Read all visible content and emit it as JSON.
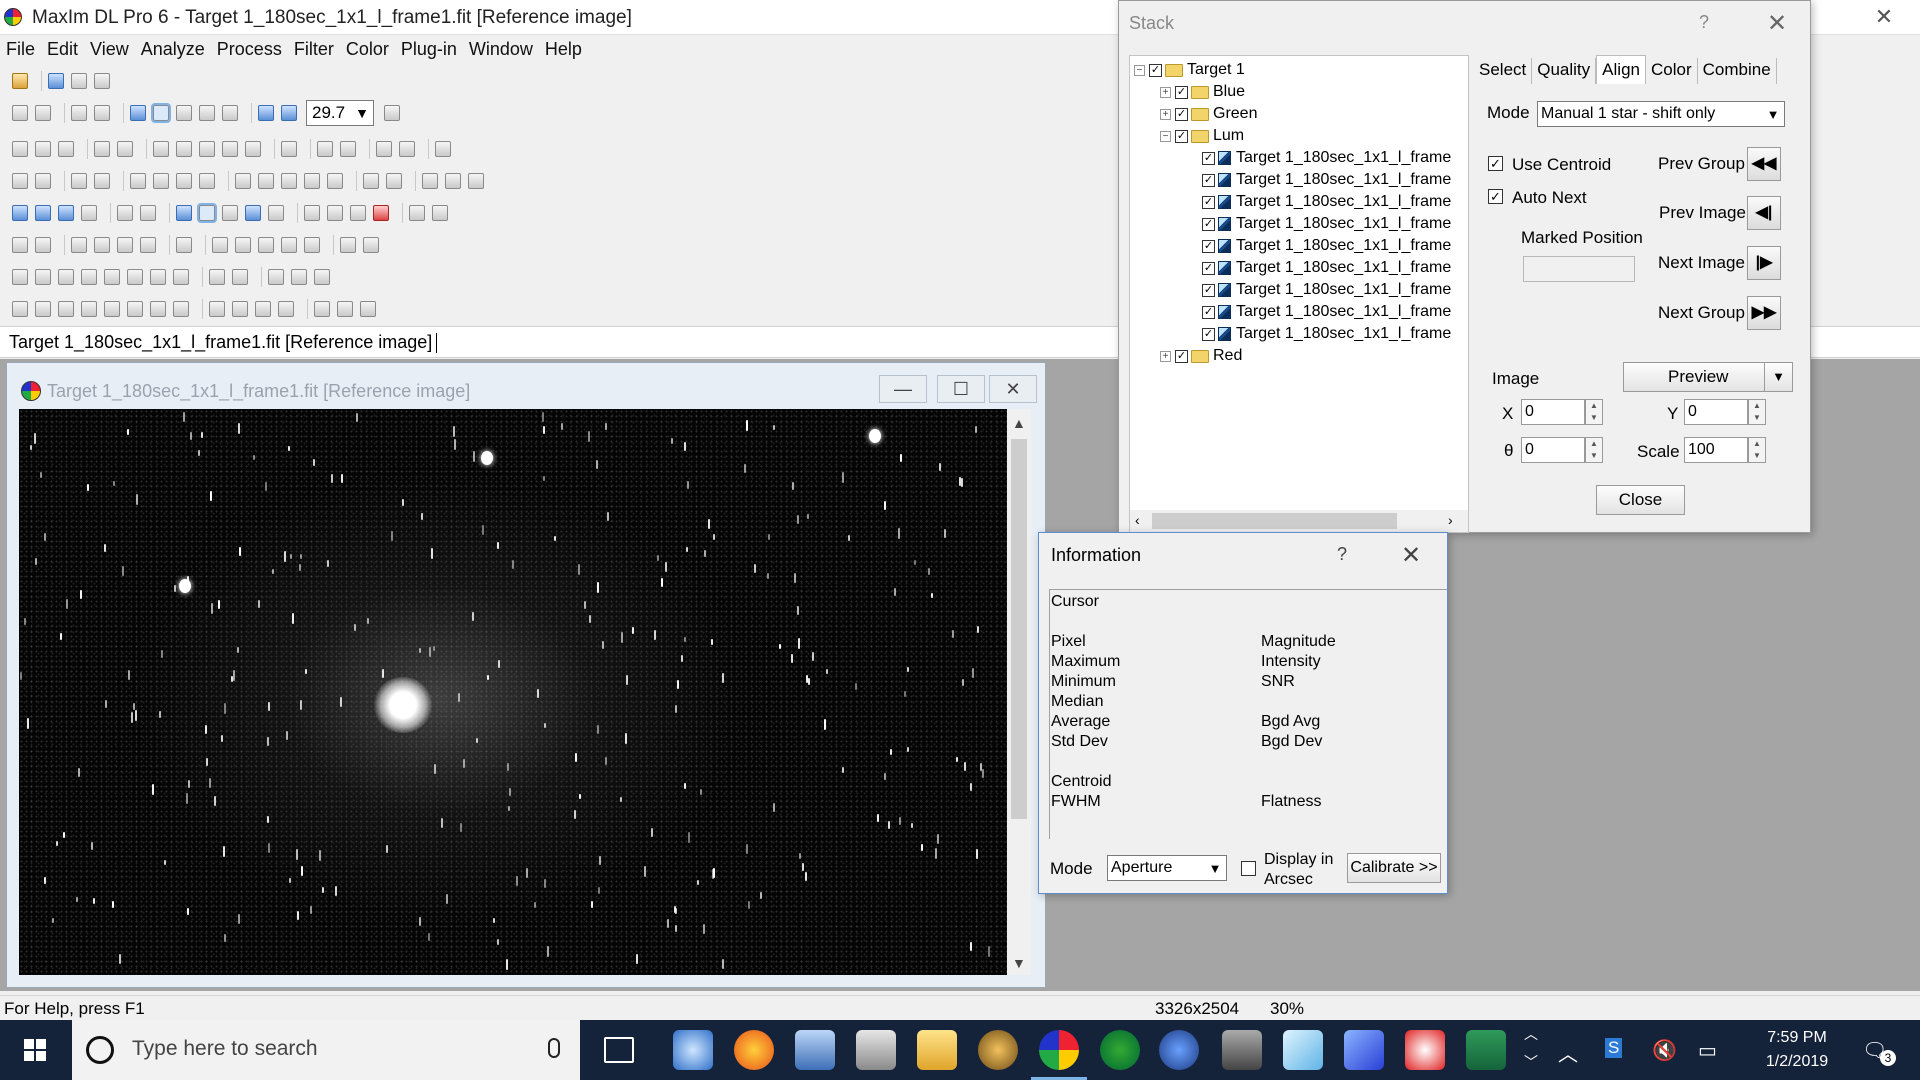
{
  "app": {
    "title": "MaxIm DL Pro 6 - Target 1_180sec_1x1_l_frame1.fit [Reference image]",
    "menu": [
      "File",
      "Edit",
      "View",
      "Analyze",
      "Process",
      "Filter",
      "Color",
      "Plug-in",
      "Window",
      "Help"
    ],
    "zoom": "29.7",
    "doc_tab": "Target 1_180sec_1x1_l_frame1.fit [Reference image]"
  },
  "image_window": {
    "title": "Target 1_180sec_1x1_l_frame1.fit [Reference image]",
    "minimize": "—",
    "maximize": "☐",
    "close": "✕"
  },
  "status": {
    "help": "For Help, press F1",
    "dims": "3326x2504",
    "zoom": "30%"
  },
  "stack": {
    "title": "Stack",
    "help": "?",
    "close_x": "✕",
    "tree": {
      "root": "Target 1",
      "groups": [
        "Blue",
        "Green",
        "Lum",
        "Red"
      ],
      "frames": [
        "Target 1_180sec_1x1_l_frame",
        "Target 1_180sec_1x1_l_frame",
        "Target 1_180sec_1x1_l_frame",
        "Target 1_180sec_1x1_l_frame",
        "Target 1_180sec_1x1_l_frame",
        "Target 1_180sec_1x1_l_frame",
        "Target 1_180sec_1x1_l_frame",
        "Target 1_180sec_1x1_l_frame",
        "Target 1_180sec_1x1_l_frame"
      ]
    },
    "tabs": [
      "Select",
      "Quality",
      "Align",
      "Color",
      "Combine"
    ],
    "active_tab": "Align",
    "mode_label": "Mode",
    "mode_value": "Manual 1 star - shift only",
    "use_centroid": "Use Centroid",
    "auto_next": "Auto Next",
    "marked_position": "Marked Position",
    "prev_group": "Prev Group",
    "prev_image": "Prev Image",
    "next_image": "Next Image",
    "next_group": "Next Group",
    "image_label": "Image",
    "preview": "Preview",
    "x_label": "X",
    "x_value": "0",
    "y_label": "Y",
    "y_value": "0",
    "theta_label": "θ",
    "theta_value": "0",
    "scale_label": "Scale",
    "scale_value": "100",
    "close_button": "Close"
  },
  "info": {
    "title": "Information",
    "help": "?",
    "close_x": "✕",
    "cursor": "Cursor",
    "left_labels": [
      "Pixel",
      "Maximum",
      "Minimum",
      "Median",
      "Average",
      "Std Dev",
      "",
      "Centroid",
      "FWHM"
    ],
    "right_labels": [
      "Magnitude",
      "Intensity",
      "SNR",
      "",
      "Bgd Avg",
      "Bgd Dev",
      "",
      "",
      "Flatness"
    ],
    "mode_label": "Mode",
    "mode_value": "Aperture",
    "display_arcsec_1": "Display in",
    "display_arcsec_2": "Arcsec",
    "calibrate": "Calibrate >>"
  },
  "taskbar": {
    "search_placeholder": "Type here to search",
    "time": "7:59 PM",
    "date": "1/2/2019",
    "notifications": "3"
  }
}
